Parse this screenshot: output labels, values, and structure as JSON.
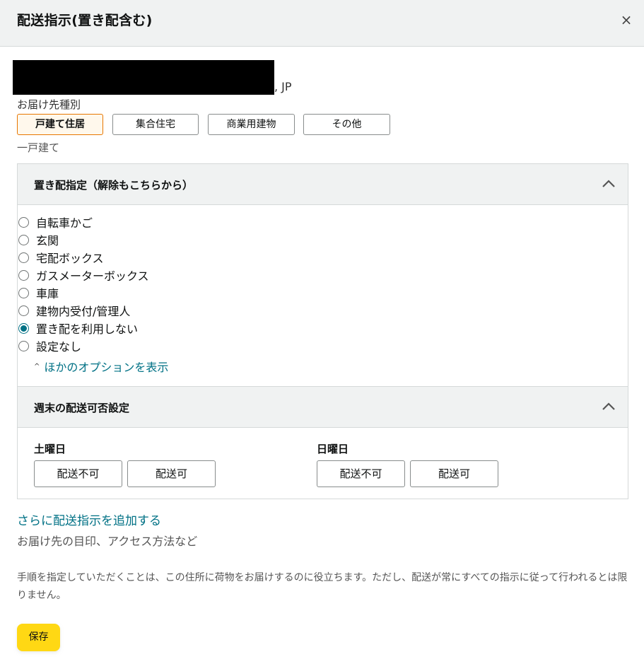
{
  "dialog": {
    "title": "配送指示(置き配含む)",
    "close_label": "×"
  },
  "address": {
    "country": ", JP"
  },
  "delivery_type": {
    "label": "お届け先種別",
    "options": [
      "戸建て住居",
      "集合住宅",
      "商業用建物",
      "その他"
    ],
    "selected": "一戸建て"
  },
  "dropoff": {
    "title": "置き配指定（解除もこちらから）",
    "options": [
      {
        "label": "自転車かご",
        "checked": false
      },
      {
        "label": "玄関",
        "checked": false
      },
      {
        "label": "宅配ボックス",
        "checked": false
      },
      {
        "label": "ガスメーターボックス",
        "checked": false
      },
      {
        "label": "車庫",
        "checked": false
      },
      {
        "label": "建物内受付/管理人",
        "checked": false
      },
      {
        "label": "置き配を利用しない",
        "checked": true
      },
      {
        "label": "設定なし",
        "checked": false
      }
    ],
    "more_options_link": "ほかのオプションを表示"
  },
  "weekend": {
    "title": "週末の配送可否設定",
    "saturday": {
      "label": "土曜日",
      "no": "配送不可",
      "yes": "配送可"
    },
    "sunday": {
      "label": "日曜日",
      "no": "配送不可",
      "yes": "配送可"
    }
  },
  "more_instructions": {
    "link": "さらに配送指示を追加する",
    "subtitle": "お届け先の目印、アクセス方法など"
  },
  "note": "手順を指定していただくことは、この住所に荷物をお届けするのに役立ちます。ただし、配送が常にすべての指示に従って行われるとは限りません。",
  "save_label": "保存",
  "colors": {
    "accent": "#007185",
    "save_button": "#ffd814",
    "active_border": "#e77600",
    "header_bg": "#f0f2f2"
  }
}
